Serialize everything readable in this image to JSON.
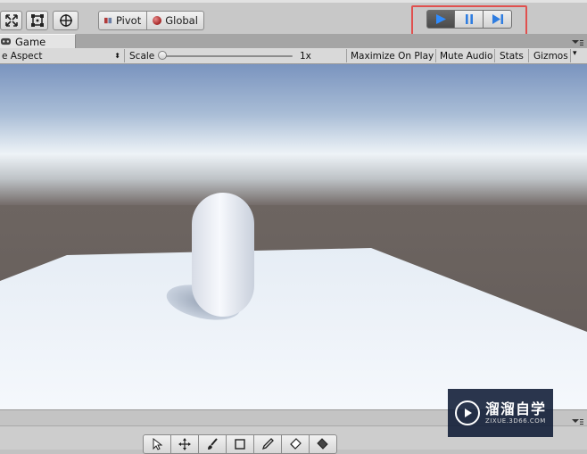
{
  "toolbar": {
    "tools": [
      {
        "icon": "scale-tool-icon"
      },
      {
        "icon": "rect-tool-icon"
      },
      {
        "icon": "transform-tool-icon"
      }
    ],
    "pivot_label": "Pivot",
    "global_label": "Global",
    "play_controls": [
      {
        "icon": "play-icon",
        "active": true
      },
      {
        "icon": "pause-icon",
        "active": false
      },
      {
        "icon": "step-icon",
        "active": false
      }
    ],
    "highlight_color": "#e0504e"
  },
  "tab": {
    "icon": "game-icon",
    "label": "Game"
  },
  "game_bar": {
    "aspect_label": "e Aspect",
    "scale_label": "Scale",
    "scale_value": "1x",
    "maximize_label": "Maximize On Play",
    "mute_label": "Mute Audio",
    "stats_label": "Stats",
    "gizmos_label": "Gizmos"
  },
  "viewport": {
    "sky_top_color": "#7d97c0",
    "horizon_color": "#eef3f7",
    "ground_color": "#6a625f",
    "plane_color": "#eff4fa",
    "capsule_color": "#f2f5fb"
  },
  "bottom_tools": [
    {
      "icon": "cursor-icon"
    },
    {
      "icon": "move-icon"
    },
    {
      "icon": "brush-icon"
    },
    {
      "icon": "rect-select-icon"
    },
    {
      "icon": "eyedropper-icon"
    },
    {
      "icon": "eraser-icon"
    },
    {
      "icon": "fill-icon"
    }
  ],
  "watermark": {
    "title": "溜溜自学",
    "url": "ZIXUE.3D66.COM"
  }
}
